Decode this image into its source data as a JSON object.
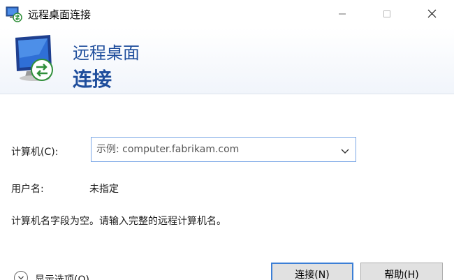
{
  "window": {
    "title": "远程桌面连接"
  },
  "banner": {
    "line1": "远程桌面",
    "line2": "连接"
  },
  "form": {
    "computer_label": "计算机(C):",
    "computer_placeholder": "示例: computer.fabrikam.com",
    "computer_value": "",
    "username_label": "用户名:",
    "username_value": "未指定",
    "message": "计算机名字段为空。请输入完整的远程计算机名。"
  },
  "footer": {
    "show_options_label": "显示选项(O)",
    "connect_label": "连接(N)",
    "help_label": "帮助(H)"
  },
  "colors": {
    "banner_text": "#1f4e9c",
    "focus_border": "#7aa7e6",
    "default_button_border": "#3c7fd6"
  },
  "icons": {
    "app": "remote-desktop-icon",
    "banner": "monitor-connection-icon",
    "minimize": "minimize-icon",
    "maximize": "maximize-icon",
    "close": "close-icon",
    "dropdown": "chevron-down-icon",
    "options": "chevron-down-circle-icon"
  }
}
